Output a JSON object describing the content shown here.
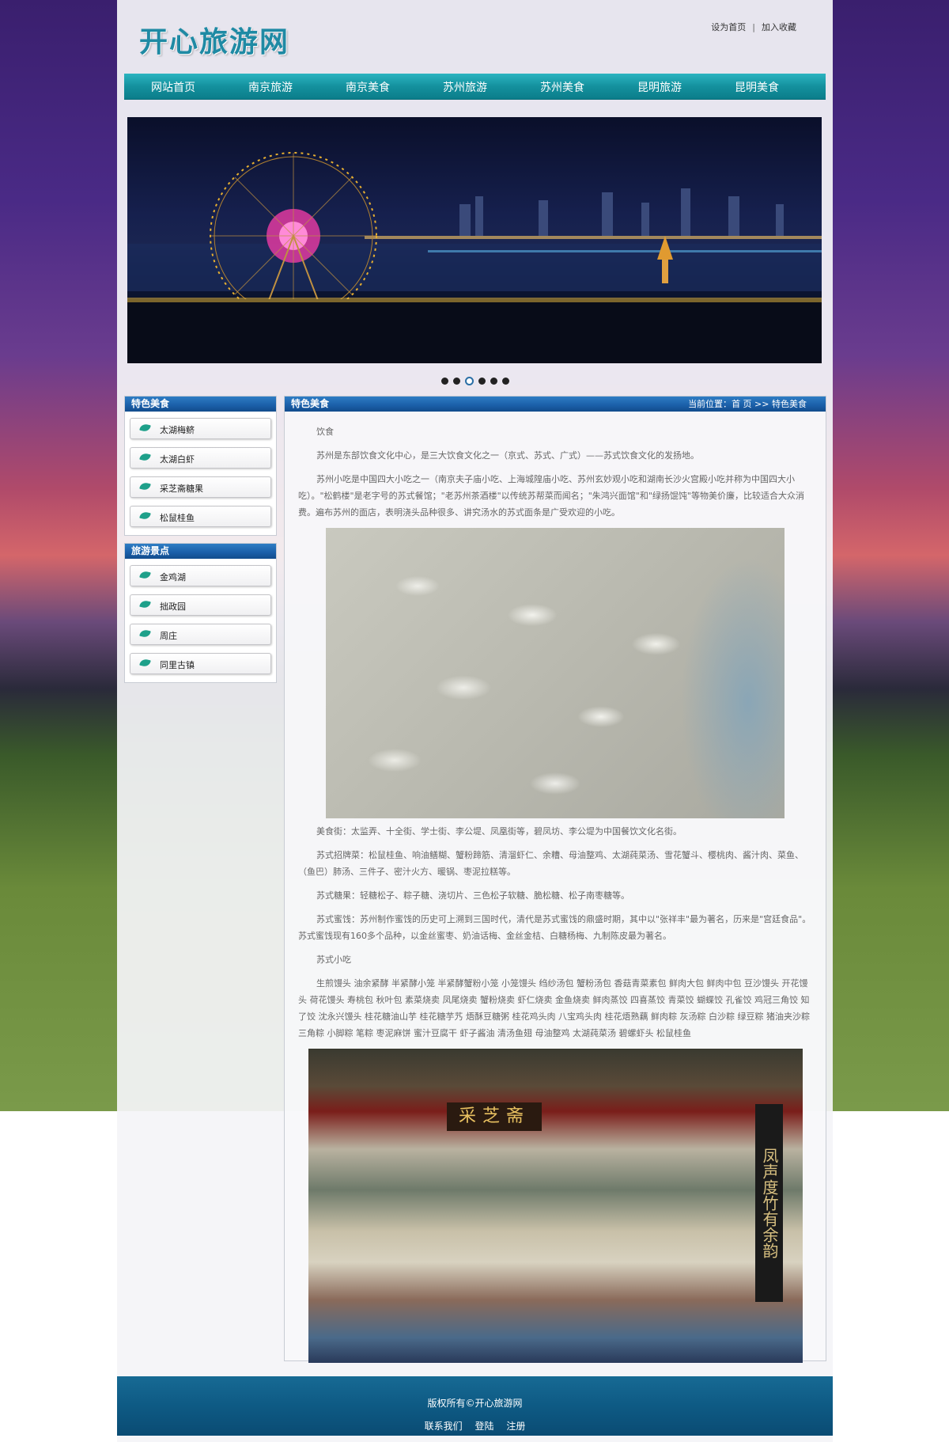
{
  "site": {
    "logo": "开心旅游网"
  },
  "toplinks": {
    "home": "设为首页",
    "separator": "|",
    "fav": "加入收藏"
  },
  "nav": [
    {
      "label": "网站首页"
    },
    {
      "label": "南京旅游"
    },
    {
      "label": "南京美食"
    },
    {
      "label": "苏州旅游"
    },
    {
      "label": "苏州美食"
    },
    {
      "label": "昆明旅游"
    },
    {
      "label": "昆明美食"
    }
  ],
  "slider": {
    "dot_count": 6,
    "active_index": 2
  },
  "sidebar": {
    "food": {
      "title": "特色美食",
      "items": [
        {
          "label": "太湖梅鲚"
        },
        {
          "label": "太湖白虾"
        },
        {
          "label": "采芝斋糖果"
        },
        {
          "label": "松鼠桂鱼"
        }
      ]
    },
    "spots": {
      "title": "旅游景点",
      "items": [
        {
          "label": "金鸡湖"
        },
        {
          "label": "拙政园"
        },
        {
          "label": "周庄"
        },
        {
          "label": "同里古镇"
        }
      ]
    }
  },
  "main": {
    "title": "特色美食",
    "breadcrumb": {
      "prefix": "当前位置：",
      "home": "首 页",
      "sep": " >> ",
      "current": "特色美食"
    },
    "paragraphs": {
      "p1": "饮食",
      "p2": "苏州是东部饮食文化中心，是三大饮食文化之一（京式、苏式、广式）——苏式饮食文化的发扬地。",
      "p3": "苏州小吃是中国四大小吃之一（南京夫子庙小吃、上海城隍庙小吃、苏州玄妙观小吃和湖南长沙火宫殿小吃并称为中国四大小吃）。\"松鹤楼\"是老字号的苏式餐馆；\"老苏州茶酒楼\"以传统苏帮菜而闻名；\"朱鸿兴面馆\"和\"绿扬馄饨\"等物美价廉，比较适合大众消费。遍布苏州的面店，表明浇头品种很多、讲究汤水的苏式面条是广受欢迎的小吃。",
      "p4": "美食街：太监弄、十全街、学士街、李公堤、凤凰街等，碧凤坊、李公堤为中国餐饮文化名街。",
      "p5": "苏式招牌菜：松鼠桂鱼、响油鳝糊、蟹粉蹄筋、清溜虾仁、余糟、母油整鸡、太湖莼菜汤、雪花蟹斗、樱桃肉、酱汁肉、菜鱼、（鱼巴）肺汤、三件子、密汁火方、暖锅、枣泥拉糕等。",
      "p6": "苏式糖果：轻糖松子、粽子糖、浇切片、三色松子软糖、脆松糖、松子南枣糖等。",
      "p7": "苏式蜜饯：苏州制作蜜饯的历史可上溯到三国时代，清代是苏式蜜饯的鼎盛时期，其中以\"张祥丰\"最为著名，历来是\"宫廷食品\"。苏式蜜饯现有160多个品种，以金丝蜜枣、奶油话梅、金丝金桔、白糖杨梅、九制陈皮最为著名。",
      "p8": "苏式小吃",
      "p9": "生煎馒头 油余紧酵 半紧酵小笼 半紧酵蟹粉小笼 小笼馒头 绉纱汤包 蟹粉汤包 香菇青菜素包 鲜肉大包 鲜肉中包 豆沙馒头 开花馒头 荷花馒头 寿桃包 秋叶包 素菜烧卖 凤尾烧卖 蟹粉烧卖 虾仁烧卖 金鱼烧卖 鲜肉蒸饺 四喜蒸饺 青菜饺 蝴蝶饺 孔雀饺 鸡冠三角饺 知了饺 沈永兴馒头 桂花糖油山芋 桂花糖芋艿 焐酥豆糖粥 桂花鸡头肉 八宝鸡头肉 桂花焐熟藕 鲜肉粽 灰汤粽 白沙粽 绿豆粽 猪油夹沙粽 三角粽 小脚粽 笔粽 枣泥麻饼 蜜汁豆腐干 虾子酱油 清汤鱼翅 母油整鸡 太湖莼菜汤 碧螺虾头 松鼠桂鱼"
    },
    "shop_sign": "采芝斋",
    "shop_pillar": "凤声度竹有余韵"
  },
  "footer": {
    "copyright": "版权所有©开心旅游网",
    "links": [
      {
        "label": "联系我们"
      },
      {
        "label": "登陆"
      },
      {
        "label": "注册"
      }
    ]
  }
}
